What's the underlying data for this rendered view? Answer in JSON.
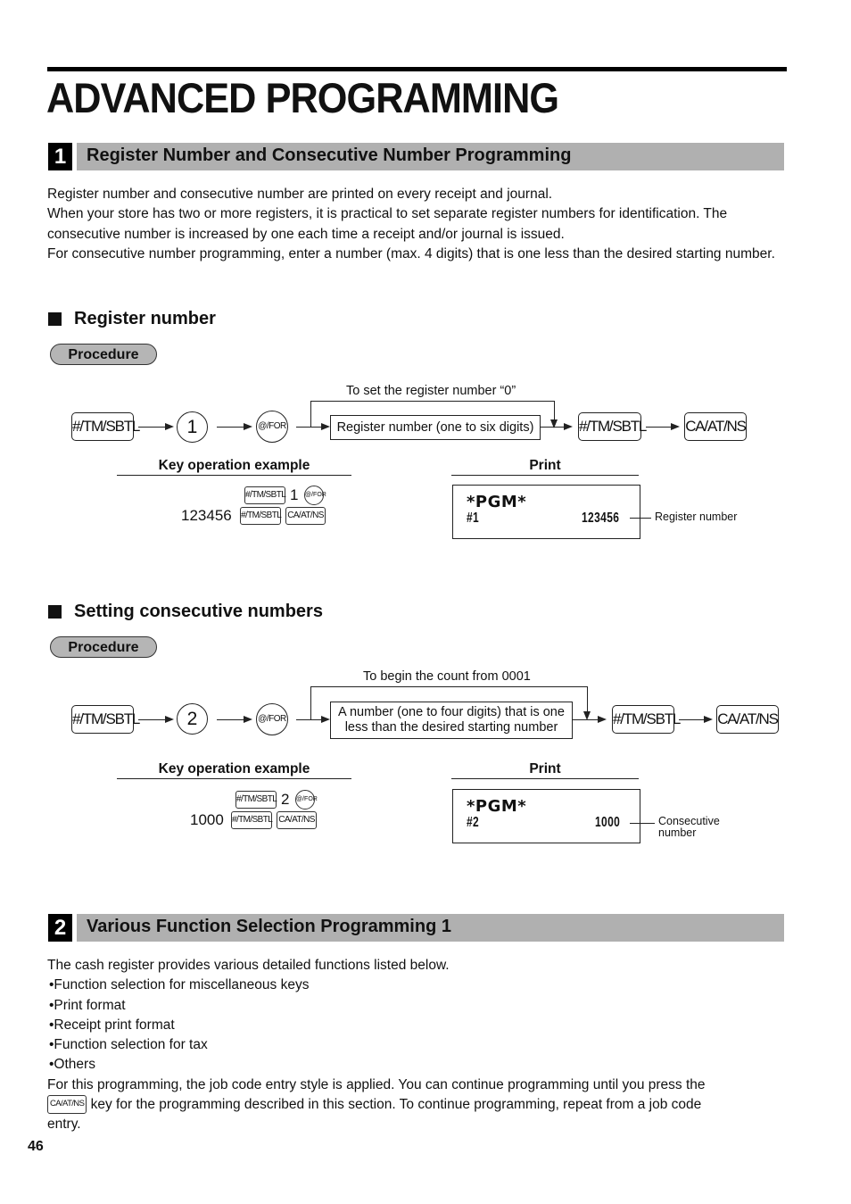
{
  "page": {
    "title": "ADVANCED PROGRAMMING",
    "page_number": "46"
  },
  "section1": {
    "number": "1",
    "heading": "Register Number and Consecutive Number Programming",
    "paragraphs": [
      "Register number and consecutive number are printed on every receipt and journal.",
      "When your store has two or more registers, it is practical to set separate register numbers for identification.  The consecutive number is increased by one each time a receipt and/or journal is issued.",
      "For consecutive number programming, enter a number (max. 4 digits) that is one less than the desired starting number."
    ],
    "register_number": {
      "subheading": "Register number",
      "procedure_label": "Procedure",
      "flow": {
        "key1": "#/TM/SBTL",
        "digit": "1",
        "for_key": "@/FOR",
        "bypass_label": "To set the register number “0”",
        "input_box": "Register number (one to six digits)",
        "key2": "#/TM/SBTL",
        "key3": "CA/AT/NS"
      },
      "key_op_header": "Key operation example",
      "key_op": {
        "line1_key": "#/TM/SBTL",
        "line1_digit": "1",
        "line1_circle": "@/FOR",
        "line2_value": "123456",
        "line2_key1": "#/TM/SBTL",
        "line2_key2": "CA/AT/NS"
      },
      "print_header": "Print",
      "print": {
        "line1": "*PGM*",
        "line2_left": "#1",
        "line2_right": "123456",
        "callout": "Register number"
      }
    },
    "consecutive": {
      "subheading": "Setting consecutive numbers",
      "procedure_label": "Procedure",
      "flow": {
        "key1": "#/TM/SBTL",
        "digit": "2",
        "for_key": "@/FOR",
        "bypass_label": "To begin the count from 0001",
        "input_box_line1": "A number (one to four digits) that is one",
        "input_box_line2": "less than the desired starting number",
        "key2": "#/TM/SBTL",
        "key3": "CA/AT/NS"
      },
      "key_op_header": "Key operation example",
      "key_op": {
        "line1_key": "#/TM/SBTL",
        "line1_digit": "2",
        "line1_circle": "@/FOR",
        "line2_value": "1000",
        "line2_key1": "#/TM/SBTL",
        "line2_key2": "CA/AT/NS"
      },
      "print_header": "Print",
      "print": {
        "line1": "*PGM*",
        "line2_left": "#2",
        "line2_right": "1000",
        "callout_line1": "Consecutive",
        "callout_line2": "number"
      }
    }
  },
  "section2": {
    "number": "2",
    "heading": "Various Function Selection Programming 1",
    "intro": "The cash register provides various detailed functions listed below.",
    "bullets": [
      "•Function selection for miscellaneous keys",
      "•Print format",
      "•Receipt print format",
      "•Function selection for tax",
      "•Others"
    ],
    "para1": "For this programming, the job code entry style is applied.  You can continue programming until you press the",
    "inline_key": "CA/AT/NS",
    "para2": " key for the programming described in this section.  To continue programming, repeat from a job code",
    "para3": "entry."
  }
}
